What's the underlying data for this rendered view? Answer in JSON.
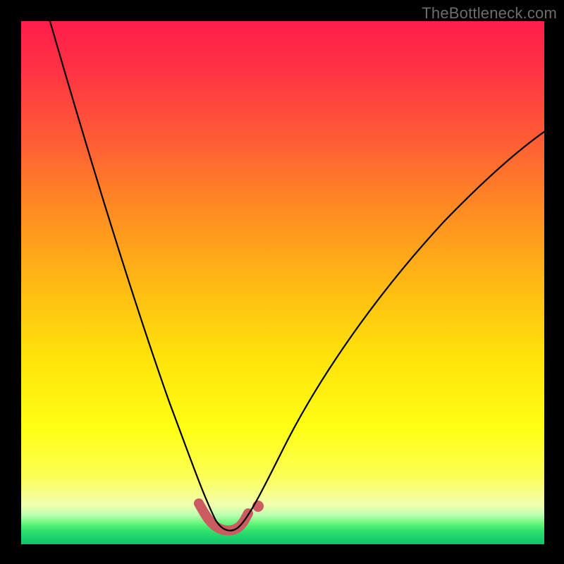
{
  "watermark": "TheBottleneck.com",
  "colors": {
    "accent": "#cc5a61",
    "curve": "#000000",
    "frame": "#000000"
  },
  "chart_data": {
    "type": "line",
    "title": "",
    "xlabel": "",
    "ylabel": "",
    "xlim": [
      0,
      100
    ],
    "ylim": [
      0,
      100
    ],
    "grid": false,
    "legend": false,
    "series": [
      {
        "name": "bottleneck-curve",
        "x": [
          6,
          10,
          14,
          18,
          22,
          26,
          29,
          31,
          33,
          34.5,
          36,
          37.5,
          39,
          40.5,
          42,
          44,
          47,
          52,
          58,
          65,
          73,
          82,
          92,
          100
        ],
        "y": [
          100,
          86,
          72,
          59,
          46,
          34,
          24,
          18,
          12,
          8,
          5,
          3,
          2.5,
          3,
          5,
          8,
          13,
          22,
          33,
          44,
          55,
          66,
          76,
          82
        ]
      }
    ],
    "highlight": {
      "name": "optimal-range",
      "x": [
        34.5,
        36,
        37.5,
        39,
        40.5,
        42
      ],
      "y": [
        8,
        5,
        3,
        2.5,
        3,
        5
      ]
    },
    "marker": {
      "x": 43.5,
      "y": 7
    }
  }
}
